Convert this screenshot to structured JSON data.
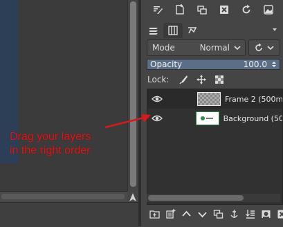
{
  "canvas": {
    "image_color": "#2c3f57"
  },
  "dock": {
    "top_toolbar": [
      "edit-layer-attributes-icon",
      "new-layer-icon",
      "duplicate-layer-icon",
      "delete-layer-icon",
      "refresh-icon",
      "view-image-icon"
    ],
    "tabs": [
      "layers-tab-icon",
      "channels-tab-icon",
      "paths-tab-icon"
    ],
    "mode": {
      "label": "Mode",
      "value": "Normal"
    },
    "opacity": {
      "label": "Opacity",
      "value": "100.0"
    },
    "lock": {
      "label": "Lock:",
      "items": [
        "lock-pixels-icon",
        "lock-position-icon",
        "lock-alpha-icon"
      ]
    },
    "layers": [
      {
        "name": "Frame 2 (500m",
        "visible": true,
        "selected": true,
        "thumb": "transparent"
      },
      {
        "name": "Background (50",
        "visible": true,
        "selected": false,
        "thumb": "image"
      }
    ],
    "bottom_toolbar": [
      "new-layer-group-icon",
      "new-layer-icon",
      "raise-layer-icon",
      "lower-layer-icon",
      "duplicate-layer-icon",
      "anchor-layer-icon",
      "merge-down-icon",
      "mask-icon",
      "delete-layer-icon"
    ]
  },
  "annotation": {
    "line1": "Drag your layers",
    "line2": "in the right order",
    "color": "#d41b1b"
  }
}
